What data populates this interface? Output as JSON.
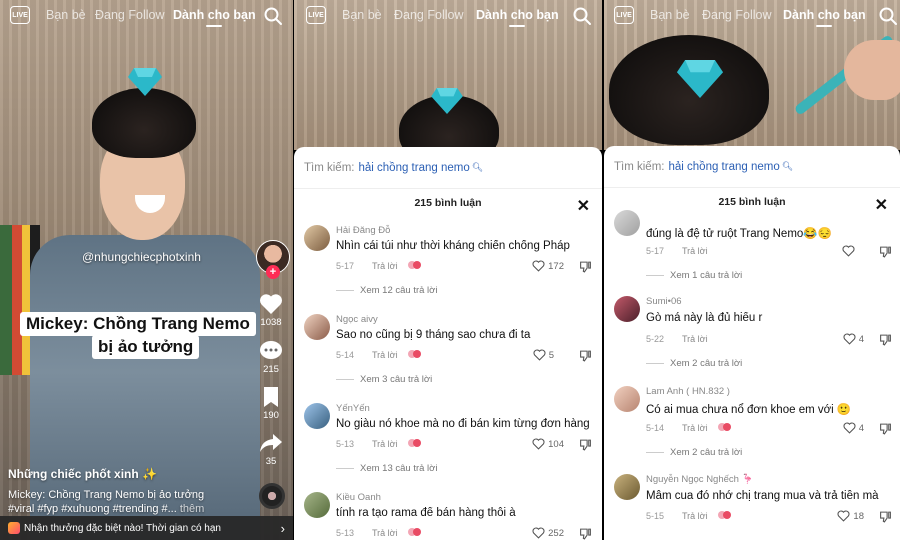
{
  "nav": {
    "live_label": "LIVE",
    "tabs": [
      "Bạn bè",
      "Đang Follow",
      "Dành cho bạn"
    ],
    "active_tab": "Dành cho bạn"
  },
  "video": {
    "handle": "@nhungchiecphotxinh",
    "caption_line1": "Mickey: Chồng Trang Nemo",
    "caption_line2": "bị ảo tưởng",
    "author": "Những chiếc phốt xinh ✨",
    "description_line1": "Mickey: Chồng Trang Nemo bị ảo tưởng",
    "description_line2": "#viral #fyp #xuhuong #trending #...",
    "more": "thêm",
    "likes": "1038",
    "comments": "215",
    "saves": "190",
    "shares": "35",
    "promo": "Nhận thưởng đặc biệt nào! Thời gian có hạn"
  },
  "search": {
    "label": "Tìm kiếm:",
    "term": "hải chồng trang nemo"
  },
  "comments_panel_2": {
    "title": "215 bình luận",
    "items": [
      {
        "name": "Hải Đăng Đỗ",
        "text": "Nhìn cái túi như thời kháng chiến chống Pháp",
        "date": "5-17",
        "reply": "Trả lời",
        "likes": "172",
        "more": "Xem 12 câu trả lời"
      },
      {
        "name": "Ngọc aivy",
        "text": "Sao no cũng bị 9 tháng sao chưa đi ta",
        "date": "5-14",
        "reply": "Trả lời",
        "likes": "5",
        "more": "Xem 3 câu trả lời"
      },
      {
        "name": "YếnYến",
        "text": "No giàu nó khoe mà no đi bán kim từng đơn hàng",
        "date": "5-13",
        "reply": "Trả lời",
        "likes": "104",
        "more": "Xem 13 câu trả lời"
      },
      {
        "name": "Kiều Oanh",
        "text": "tính ra tạo rama để bán hàng thôi à",
        "date": "5-13",
        "reply": "Trả lời",
        "likes": "252",
        "more": ""
      }
    ]
  },
  "comments_panel_3": {
    "title": "215 bình luận",
    "items": [
      {
        "name": "",
        "text": "đúng là đệ tử ruột Trang Nemo😂😔",
        "date": "5-17",
        "reply": "Trả lời",
        "likes": "",
        "more": "Xem 1 câu trả lời"
      },
      {
        "name": "Sumi•06",
        "text": "Gò má này là đủ hiểu r",
        "date": "5-22",
        "reply": "Trả lời",
        "likes": "4",
        "more": "Xem 2 câu trả lời"
      },
      {
        "name": "Lam Anh ( HN.832 )",
        "text": "Có ai mua chưa nổ đơn khoe em với 🙂",
        "date": "5-14",
        "reply": "Trả lời",
        "likes": "4",
        "more": "Xem 2 câu trả lời"
      },
      {
        "name": "Nguyễn Ngọc Nghếch 🦩",
        "text": "Mâm cua đó nhớ chị trang mua và trả tiền mà",
        "date": "5-15",
        "reply": "Trả lời",
        "likes": "18",
        "more": ""
      }
    ]
  },
  "colors": {
    "accent": "#fe2c55",
    "search_term": "#2b5fb4",
    "gem": "#2bb8c9"
  }
}
